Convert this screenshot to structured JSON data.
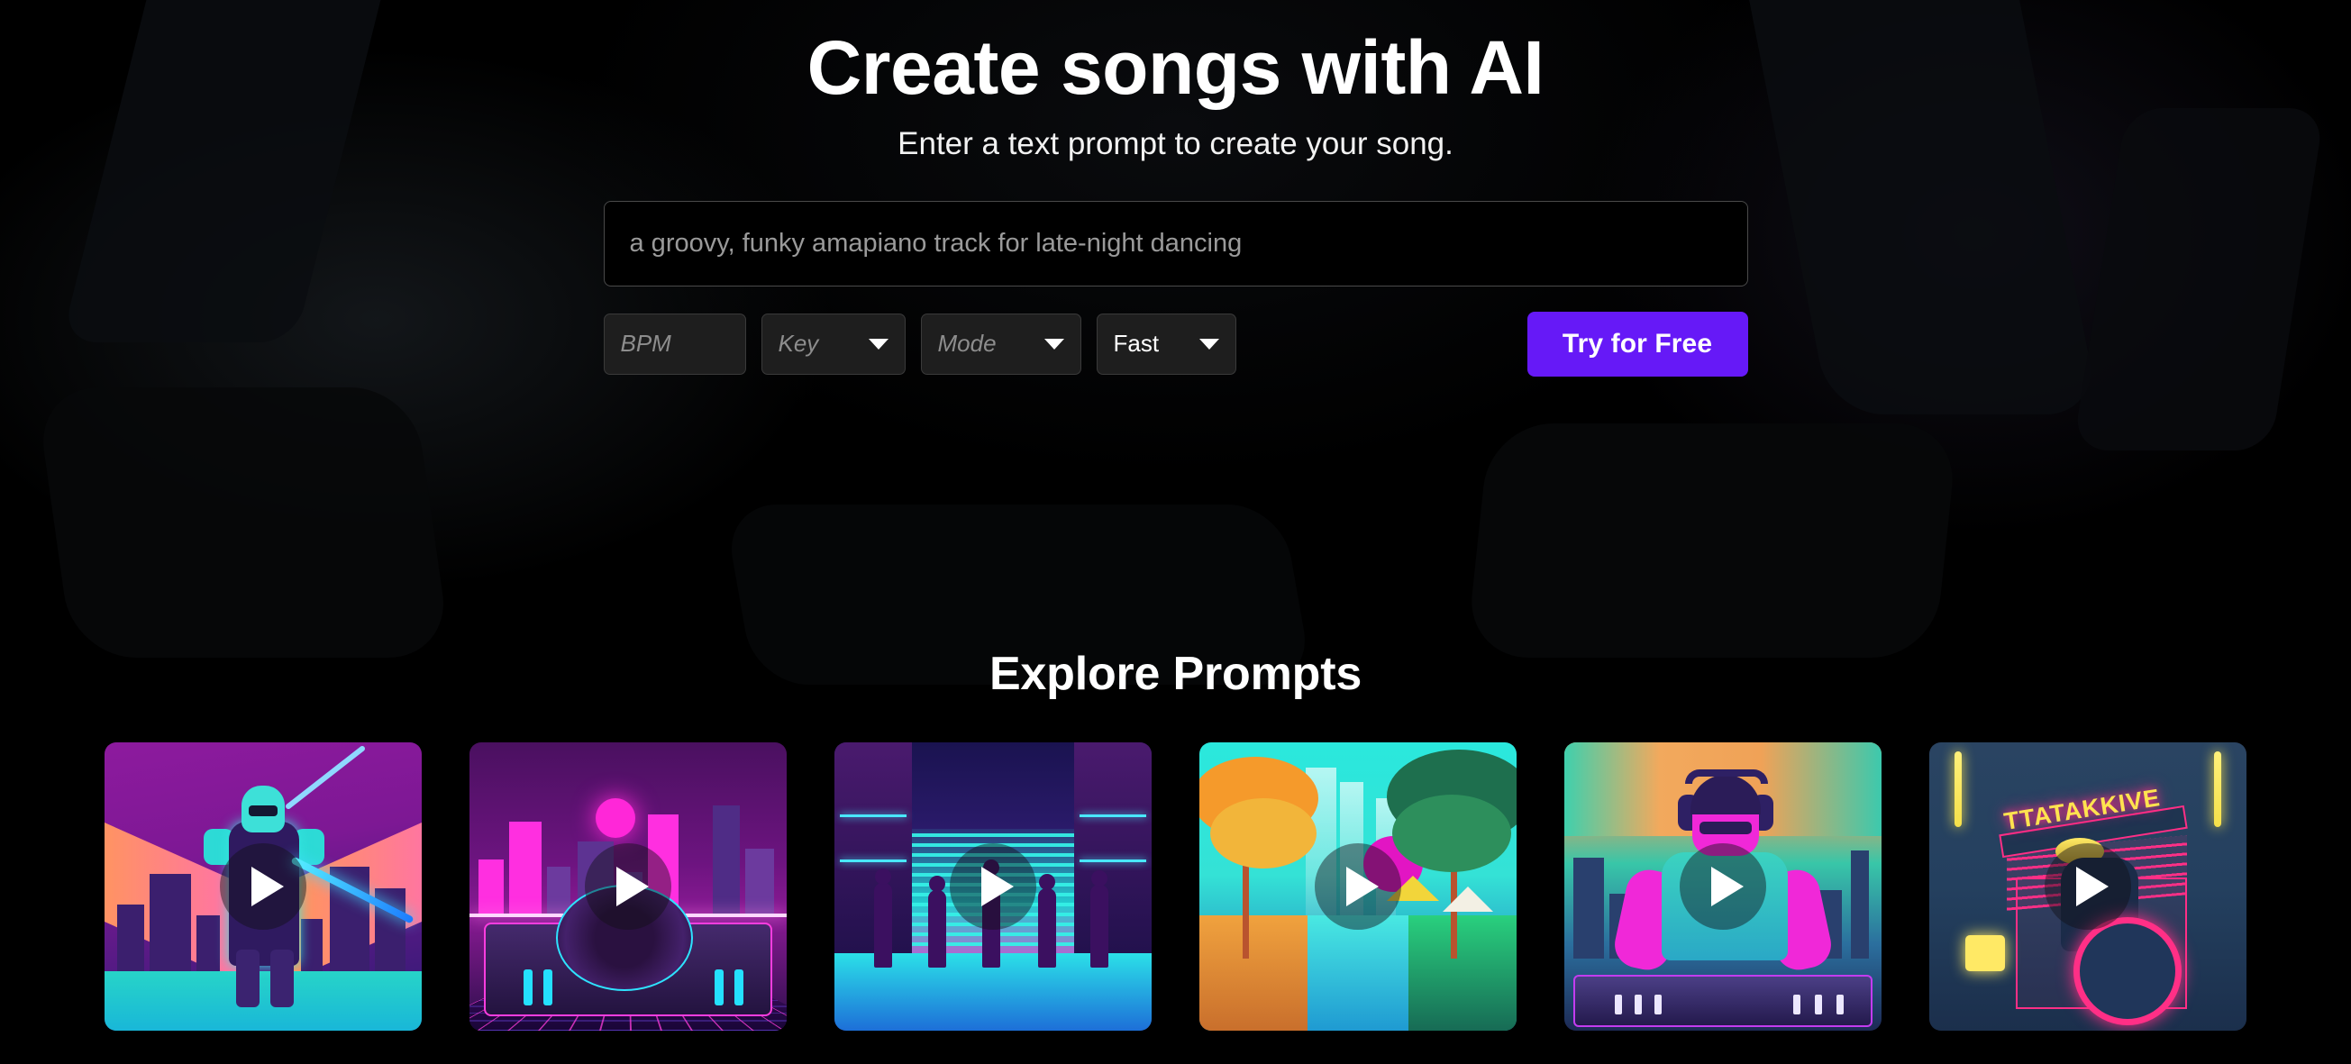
{
  "hero": {
    "title": "Create songs with AI",
    "subtitle": "Enter a text prompt to create your song.",
    "prompt_input": {
      "value": "",
      "placeholder": "a groovy, funky amapiano track for late-night dancing"
    },
    "controls": {
      "bpm": {
        "label": "BPM",
        "value": "",
        "is_placeholder": true
      },
      "key": {
        "label": "Key",
        "value": "",
        "is_placeholder": true
      },
      "mode": {
        "label": "Mode",
        "value": "",
        "is_placeholder": true
      },
      "speed": {
        "label": "Fast",
        "value": "Fast",
        "is_placeholder": false
      }
    },
    "cta_label": "Try for Free"
  },
  "explore": {
    "title": "Explore Prompts",
    "play_icon": "play-icon",
    "cards": [
      {
        "id": "card-1",
        "art": "cyber-knight-neon-city",
        "play_label": "Play"
      },
      {
        "id": "card-2",
        "art": "synthwave-turntable-skyline",
        "play_label": "Play"
      },
      {
        "id": "card-3",
        "art": "neon-dancers-alley",
        "play_label": "Play"
      },
      {
        "id": "card-4",
        "art": "tropical-canal-palms",
        "play_label": "Play"
      },
      {
        "id": "card-5",
        "art": "dj-headphones-mixer",
        "play_label": "Play"
      },
      {
        "id": "card-6",
        "art": "neon-drum-sign",
        "sign_text": "TTATAKKIVE",
        "play_label": "Play"
      }
    ]
  },
  "colors": {
    "background": "#000000",
    "accent_purple": "#6619f7",
    "text_primary": "#ffffff",
    "text_muted": "#9a9a9a",
    "control_bg": "#1e1e1e",
    "control_border": "#3a3a3a",
    "input_border": "#4a4a4a"
  }
}
